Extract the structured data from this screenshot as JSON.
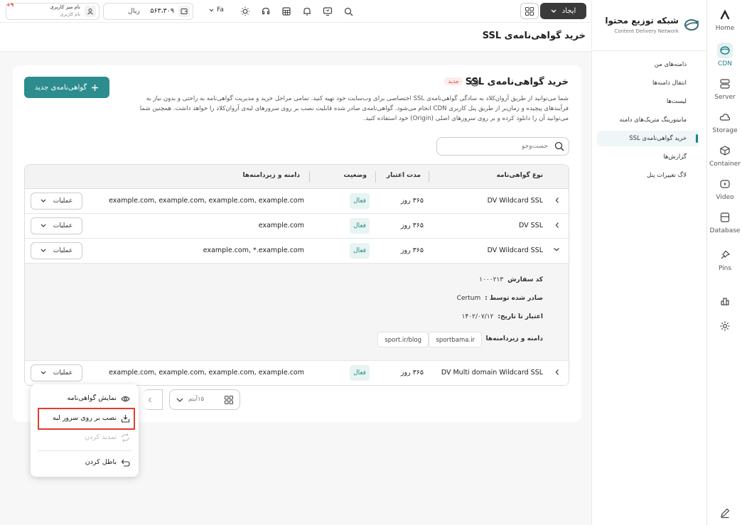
{
  "header": {
    "create_label": "ایجاد",
    "lang_label": "Fa",
    "balance": "۵۶۳،۳۰۹",
    "currency": "ریال",
    "user_name": "نام میز کاربری",
    "user_sub": "نام کاربری",
    "notification_count": "+۹"
  },
  "brand": {
    "title": "شبکه توزیع محتوا",
    "subtitle": "Content Delivery Network"
  },
  "rail": [
    {
      "label": "Home",
      "icon": "arvan-logo-icon"
    },
    {
      "label": "CDN",
      "icon": "cdn-icon"
    },
    {
      "label": "Server",
      "icon": "server-icon"
    },
    {
      "label": "Storage",
      "icon": "cloud-icon"
    },
    {
      "label": "Container",
      "icon": "container-icon"
    },
    {
      "label": "Video",
      "icon": "video-icon"
    },
    {
      "label": "Database",
      "icon": "database-icon"
    },
    {
      "label": "Pins",
      "icon": "pin-icon"
    }
  ],
  "sidebar": {
    "items": [
      {
        "label": "دامنه‌های من"
      },
      {
        "label": "انتقال دامنه‌ها"
      },
      {
        "label": "لیست‌ها"
      },
      {
        "label": "مانیتورینگ متریک‌های دامنه"
      },
      {
        "label": "خرید گواهی‌نامه‌ی SSL"
      },
      {
        "label": "گزارش‌ها"
      },
      {
        "label": "لاگ تغییرات پنل"
      }
    ]
  },
  "page": {
    "title": "خرید گواهی‌نامه‌ی SSL"
  },
  "card": {
    "title": "خرید گواهی‌نامه‌ی SSL",
    "badge": "جدید",
    "description": "شما می‌توانید از طریق آروان‌کلاد به سادگی گواهی‌نامه‌ی SSL اختصاصی برای وب‌سایت خود تهیه کنید. تمامی مراحل خرید و مدیریت گواهی‌نامه به راحتی و بدون نیاز به فرآیندهای پیچیده و زمان‌بر از طریق پنل کاربری CDN انجام می‌شود. گواهی‌نامه‌ی صادر شده قابلیت نصب بر روی سرورهای لبه‌ی آروان‌کلاد را خواهد داشت. همچنین شما می‌توانید آن را دانلود کرده و بر روی سرورهای اصلی (Origin) خود استفاده کنید.",
    "new_button": "گواهی‌نامه‌ی جدید",
    "search_placeholder": "جست‌وجو"
  },
  "table": {
    "headers": {
      "type": "نوع گواهی‌نامه",
      "period": "مدت اعتبار",
      "status": "وضعیت",
      "domains": "دامنه و زیردامنه‌ها"
    },
    "rows": [
      {
        "type": "DV Wildcard SSL",
        "period": "۳۶۵ روز",
        "status": "فعال",
        "domains": "example.com, example.com, example.com, example.com",
        "ops": "عملیات"
      },
      {
        "type": "DV SSL",
        "period": "۳۶۵ روز",
        "status": "فعال",
        "domains": "example.com",
        "ops": "عملیات"
      },
      {
        "type": "DV Wildcard SSL",
        "period": "۳۶۵ روز",
        "status": "فعال",
        "domains": "example.com, *.example.com",
        "ops": "عملیات"
      },
      {
        "type": "DV Multi domain Wildcard SSL",
        "period": "۳۶۵ روز",
        "status": "فعال",
        "domains": "example.com, example.com, example.com, example.com",
        "ops": "عملیات"
      }
    ],
    "detail": {
      "order_label": "کد سفارش",
      "order_value": "۱۰۰۰۲۱۳",
      "issuer_label": "صادر شده توسط :",
      "issuer_value": "Certum",
      "valid_label": "اعتبار تا تاریخ:",
      "valid_value": "۱۴۰۲/۰۷/۱۲",
      "domains_label": "دامنه و زیردامنه‌ها",
      "tags": [
        "sportbama.ir",
        "sport.ir/blog"
      ]
    }
  },
  "pagination": {
    "per_page": "۱۵آیتم"
  },
  "menu": {
    "items": [
      {
        "label": "نمایش گواهی‌نامه"
      },
      {
        "label": "نصب بر روی سرور لبه"
      },
      {
        "label": "تمدید کردن"
      },
      {
        "label": "باطل کردن"
      }
    ]
  },
  "colors": {
    "accent": "#2c8c8e",
    "highlight": "#e23b2e",
    "create_button": "#3a3a3a"
  }
}
